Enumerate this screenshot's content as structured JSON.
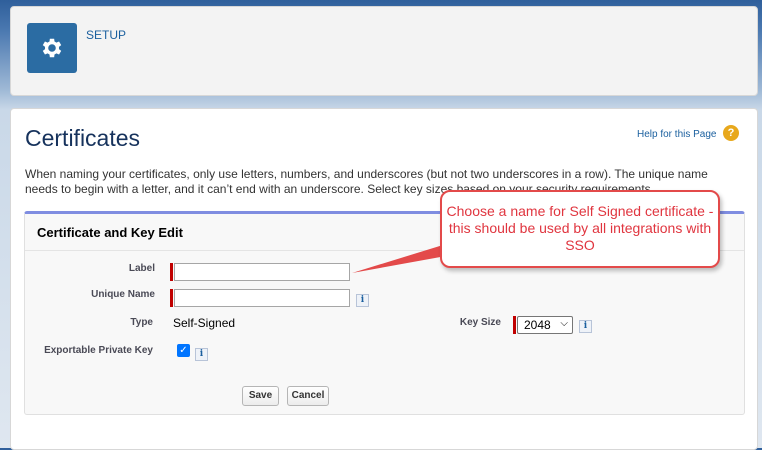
{
  "header": {
    "setup_label": "SETUP"
  },
  "page": {
    "title": "Certificates",
    "help_link": "Help for this Page",
    "help_icon": "?",
    "intro": "When naming your certificates, only use letters, numbers, and underscores (but not two underscores in a row). The unique name needs to begin with a letter, and it can’t end with an underscore. Select key sizes based on your security requirements."
  },
  "panel": {
    "title": "Certificate and Key Edit",
    "fields": {
      "label": {
        "label": "Label",
        "value": ""
      },
      "unique_name": {
        "label": "Unique Name",
        "value": ""
      },
      "type": {
        "label": "Type",
        "value": "Self-Signed"
      },
      "key_size": {
        "label": "Key Size",
        "value": "2048",
        "options": [
          "2048"
        ]
      },
      "exportable": {
        "label": "Exportable Private Key",
        "checked": true
      }
    },
    "info_glyph": "i",
    "buttons": {
      "save": "Save",
      "cancel": "Cancel"
    }
  },
  "callout": {
    "text": "Choose a name for Self Signed certificate - this should be used by all integrations with SSO"
  },
  "colors": {
    "accent": "#2b6ca3",
    "link": "#1a5f9e",
    "required": "#c00000",
    "callout": "#e34a4a"
  }
}
